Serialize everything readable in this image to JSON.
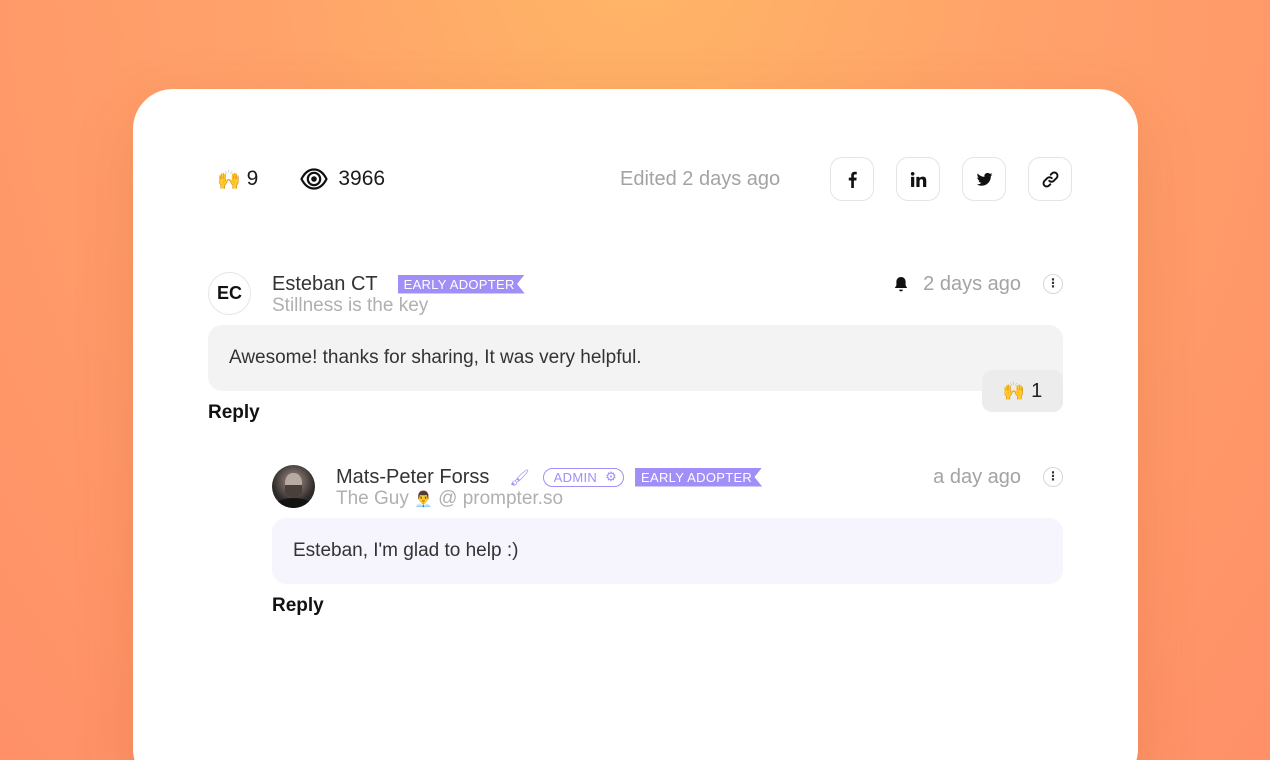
{
  "stats": {
    "claps_emoji": "🙌",
    "claps_count": "9",
    "views_count": "3966",
    "edited": "Edited 2 days ago"
  },
  "share": [
    {
      "icon": "facebook-icon"
    },
    {
      "icon": "linkedin-icon"
    },
    {
      "icon": "twitter-icon"
    },
    {
      "icon": "link-icon"
    }
  ],
  "comments": [
    {
      "initials": "EC",
      "name": "Esteban CT",
      "badge": "EARLY ADOPTER",
      "tagline": "Stillness is the key",
      "time": "2 days ago",
      "text": "Awesome! thanks for sharing, It was very helpful.",
      "reaction_emoji": "🙌",
      "reaction_count": "1",
      "reply": "Reply"
    },
    {
      "name": "Mats-Peter Forss",
      "admin_badge": "ADMIN",
      "badge": "EARLY ADOPTER",
      "tagline_pre": "The Guy",
      "tagline_emoji": "👨‍💼",
      "tagline_post": "@ prompter.so",
      "time": "a day ago",
      "text": "Esteban, I'm glad to help :)",
      "reply": "Reply"
    }
  ],
  "colors": {
    "accent": "#a18ff7",
    "muted_text": "#a3a3a3",
    "bg_gradient_top": "#ffb766",
    "bg_gradient_bottom": "#ff9068"
  }
}
